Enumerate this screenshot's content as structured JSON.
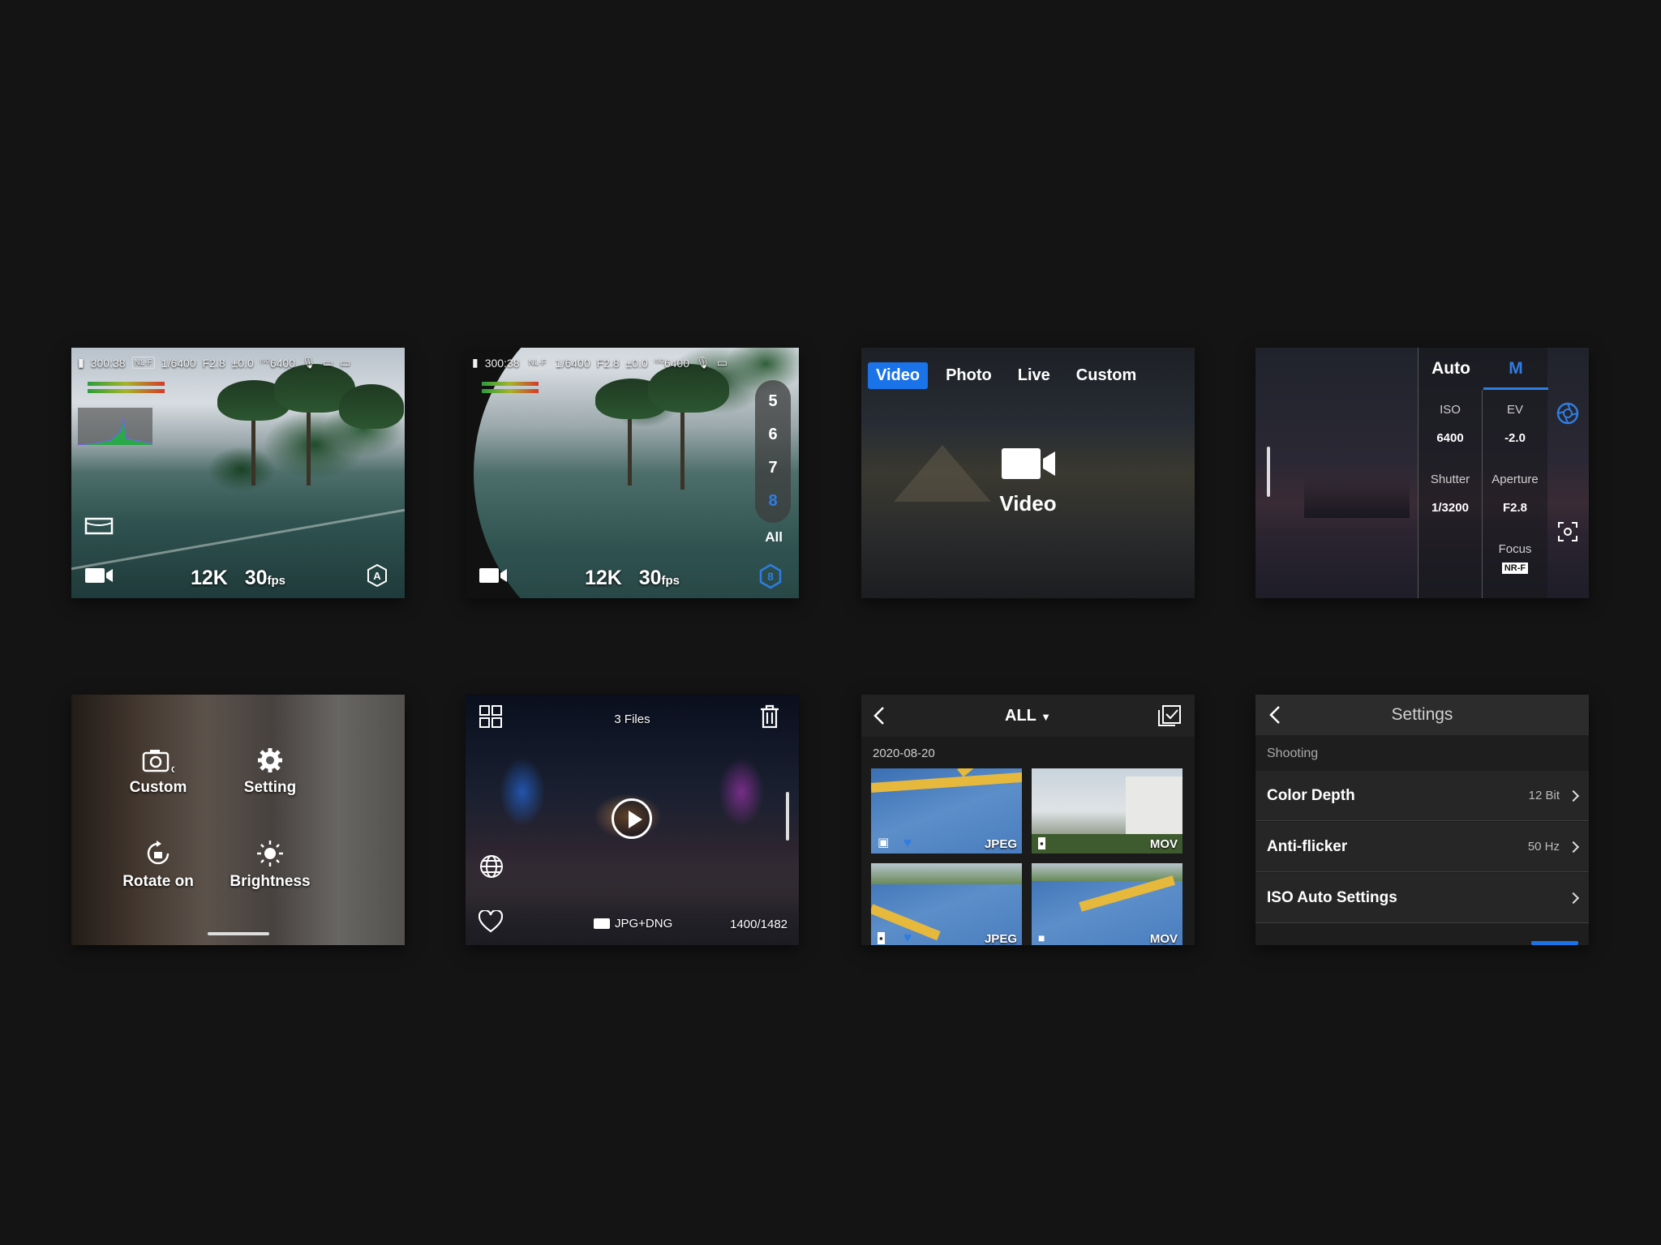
{
  "screens": {
    "live_view": {
      "record_time": "300:38",
      "color_profile": "NL-F",
      "shutter": "1/6400",
      "aperture": "F2.8",
      "ev": "±0.0",
      "iso_label": "ISO",
      "iso": "6400",
      "resolution": "12K",
      "fps_value": "30",
      "fps_unit": "fps"
    },
    "lens_select": {
      "record_time": "300:38",
      "color_profile": "NL-F",
      "shutter": "1/6400",
      "aperture": "F2.8",
      "ev": "±0.0",
      "iso_label": "ISO",
      "iso": "6400",
      "lens_options": [
        "5",
        "6",
        "7",
        "8",
        "All"
      ],
      "selected_lens": "8",
      "badge": "8",
      "resolution": "12K",
      "fps_value": "30",
      "fps_unit": "fps"
    },
    "mode_select": {
      "tabs": [
        "Video",
        "Photo",
        "Live",
        "Custom"
      ],
      "active_tab": "Video",
      "mode_label": "Video"
    },
    "manual": {
      "auto_label": "Auto",
      "manual_label": "M",
      "iso_label": "ISO",
      "iso_value": "6400",
      "ev_label": "EV",
      "ev_value": "-2.0",
      "shutter_label": "Shutter",
      "shutter_value": "1/3200",
      "aperture_label": "Aperture",
      "aperture_value": "F2.8",
      "focus_label": "Focus",
      "focus_value": "NR-F"
    },
    "quick_menu": {
      "custom_label": "Custom",
      "setting_label": "Setting",
      "rotate_label": "Rotate on",
      "brightness_label": "Brightness",
      "custom_glyph": "C"
    },
    "playback": {
      "files_count": "3 Files",
      "format": "JPG+DNG",
      "counter": "1400/1482"
    },
    "album": {
      "filter": "ALL",
      "date": "2020-08-20",
      "thumbs": [
        {
          "tag": "JPEG"
        },
        {
          "tag": "MOV"
        },
        {
          "tag": "JPEG"
        },
        {
          "tag": "MOV"
        }
      ]
    },
    "settings": {
      "title": "Settings",
      "section": "Shooting",
      "rows": [
        {
          "label": "Color Depth",
          "value": "12 Bit"
        },
        {
          "label": "Anti-flicker",
          "value": "50 Hz"
        },
        {
          "label": "ISO Auto Settings",
          "value": ""
        }
      ]
    }
  }
}
